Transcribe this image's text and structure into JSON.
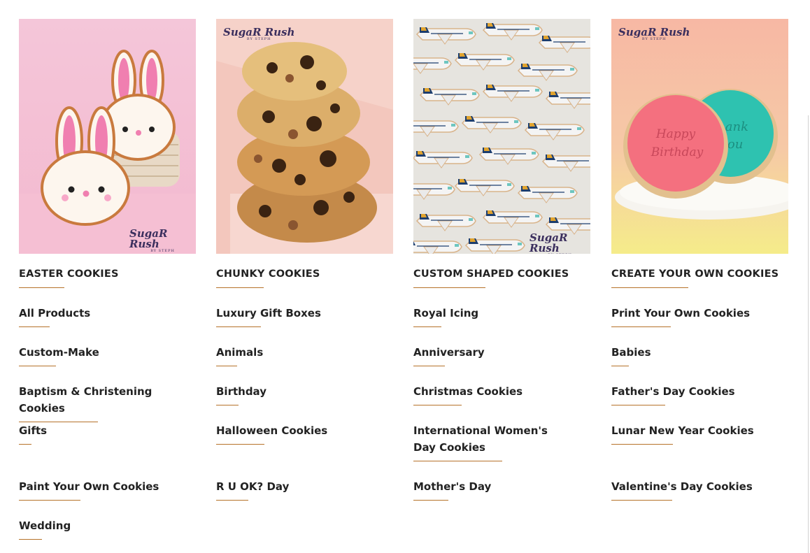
{
  "brand": {
    "logo_text": "SugaR Rush",
    "logo_sub": "BY STEPH",
    "accent_color": "#b6722a"
  },
  "columns": [
    {
      "image_alt": "Easter bunny cookies in a basket",
      "heading": "EASTER COOKIES",
      "links": [
        "All Products",
        "Custom-Make",
        "Baptism & Christening Cookies",
        "Gifts",
        "Paint Your Own Cookies",
        "Wedding"
      ]
    },
    {
      "image_alt": "Stacked chunky chocolate chip cookies",
      "heading": "CHUNKY COOKIES",
      "links": [
        "Luxury Gift Boxes",
        "Animals",
        "Birthday",
        "Halloween Cookies",
        "R U OK? Day"
      ]
    },
    {
      "image_alt": "Singapore Airlines airplane shaped cookies",
      "heading": "CUSTOM SHAPED COOKIES",
      "links": [
        "Royal Icing",
        "Anniversary",
        "Christmas Cookies",
        "International Women's Day Cookies",
        "Mother's Day"
      ]
    },
    {
      "image_alt": "Happy Birthday and Thank You embossed cookies",
      "heading": "CREATE YOUR OWN COOKIES",
      "links": [
        "Print Your Own Cookies",
        "Babies",
        "Father's Day Cookies",
        "Lunar New Year Cookies",
        "Valentine's Day Cookies"
      ]
    }
  ]
}
